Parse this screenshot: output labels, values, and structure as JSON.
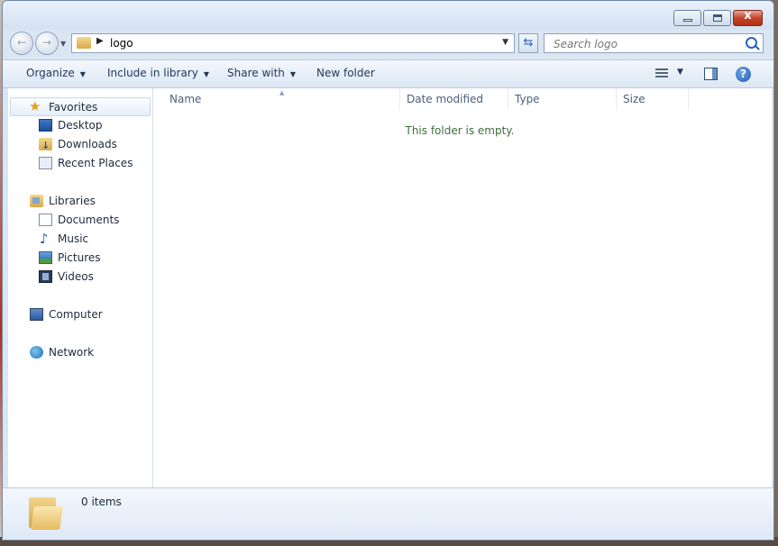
{
  "window": {
    "close_glyph": "x"
  },
  "address": {
    "crumb": "logo"
  },
  "search": {
    "placeholder": "Search logo"
  },
  "toolbar": {
    "organize": "Organize",
    "include_library": "Include in library",
    "share_with": "Share with",
    "new_folder": "New folder",
    "help": "?"
  },
  "sidebar": {
    "favorites": "Favorites",
    "favorites_items": [
      "Desktop",
      "Downloads",
      "Recent Places"
    ],
    "libraries": "Libraries",
    "libraries_items": [
      "Documents",
      "Music",
      "Pictures",
      "Videos"
    ],
    "computer": "Computer",
    "network": "Network"
  },
  "columns": [
    "Name",
    "Date modified",
    "Type",
    "Size"
  ],
  "content": {
    "empty_message": "This folder is empty."
  },
  "details": {
    "item_count": "0 items"
  },
  "icons": {
    "favorites": "star-icon",
    "desktop": "desktop-icon",
    "downloads": "downloads-icon",
    "recent": "recent-places-icon",
    "libraries": "libraries-icon",
    "documents": "documents-icon",
    "music": "music-icon",
    "pictures": "pictures-icon",
    "videos": "videos-icon",
    "computer": "computer-icon",
    "network": "network-icon"
  }
}
